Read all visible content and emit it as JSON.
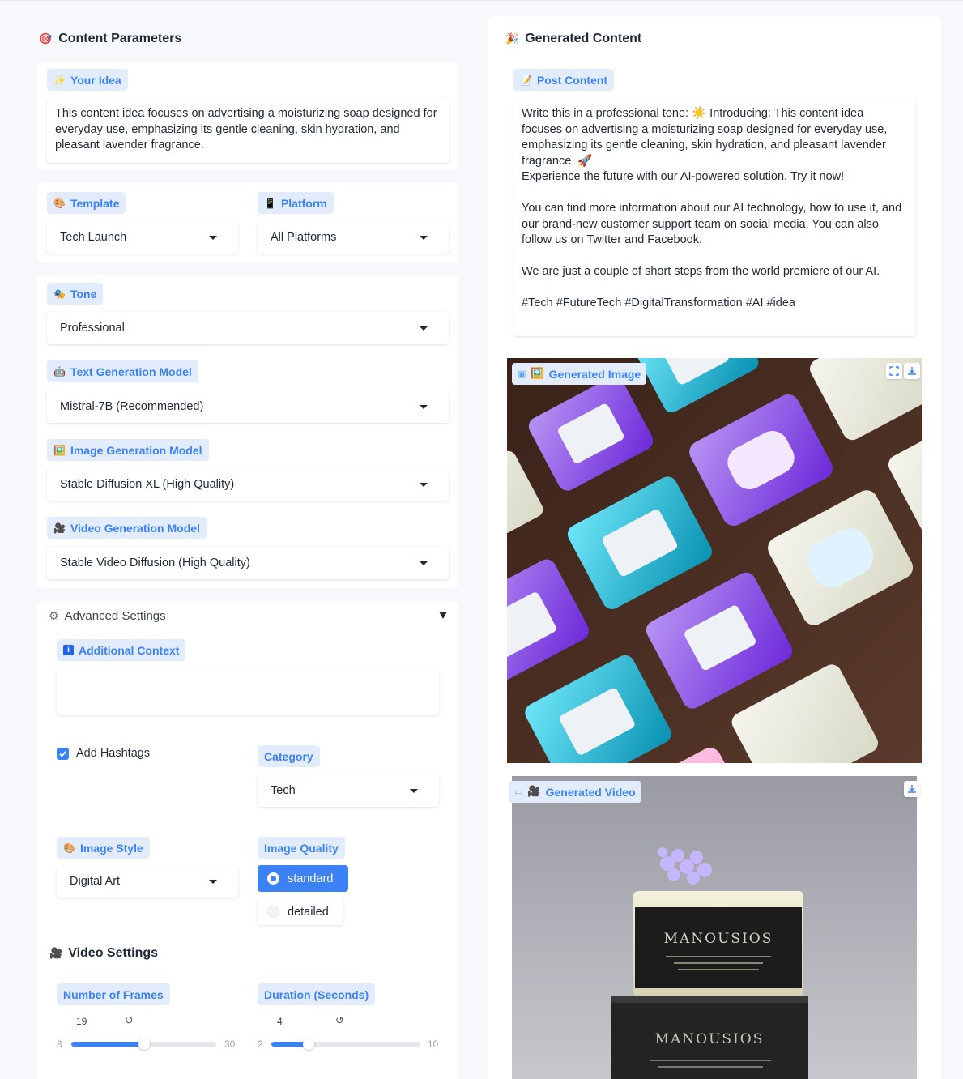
{
  "left": {
    "title": "Content Parameters",
    "idea": {
      "label": "Your Idea",
      "value": "This content idea focuses on advertising a moisturizing soap designed for everyday use, emphasizing its gentle cleaning, skin hydration, and pleasant lavender fragrance."
    },
    "template": {
      "label": "Template",
      "value": "Tech Launch"
    },
    "platform": {
      "label": "Platform",
      "value": "All Platforms"
    },
    "tone": {
      "label": "Tone",
      "value": "Professional"
    },
    "text_model": {
      "label": "Text Generation Model",
      "value": "Mistral-7B (Recommended)"
    },
    "image_model": {
      "label": "Image Generation Model",
      "value": "Stable Diffusion XL (High Quality)"
    },
    "video_model": {
      "label": "Video Generation Model",
      "value": "Stable Video Diffusion (High Quality)"
    },
    "advanced": {
      "title": "Advanced Settings",
      "expanded": true,
      "additional_context": {
        "label": "Additional Context",
        "value": ""
      },
      "add_hashtags": {
        "label": "Add Hashtags",
        "checked": true
      },
      "category": {
        "label": "Category",
        "value": "Tech"
      },
      "image_style": {
        "label": "Image Style",
        "value": "Digital Art"
      },
      "image_quality": {
        "label": "Image Quality",
        "options": [
          "standard",
          "detailed"
        ],
        "selected": "standard"
      }
    },
    "video_settings": {
      "title": "Video Settings",
      "frames": {
        "label": "Number of Frames",
        "value": 19,
        "min": 8,
        "max": 30,
        "reset": "↺"
      },
      "duration": {
        "label": "Duration (Seconds)",
        "value": 4,
        "min": 2,
        "max": 10,
        "reset": "↺"
      }
    }
  },
  "right": {
    "title": "Generated Content",
    "post": {
      "label": "Post Content",
      "paragraphs": [
        "Write this in a professional tone: ☀️ Introducing: This content idea focuses on advertising a moisturizing soap designed for everyday use, emphasizing its gentle cleaning, skin hydration, and pleasant lavender fragrance.  🚀",
        "Experience the future with our AI-powered solution. Try it now!",
        "",
        "You can find more information about our AI technology, how to use it, and our brand-new customer support team on social media. You can also follow us on Twitter and Facebook.",
        "",
        "We are just a couple of short steps from the world premiere of our AI.",
        "",
        "#Tech #FutureTech #DigitalTransformation #AI #idea"
      ]
    },
    "image": {
      "label": "Generated Image"
    },
    "video": {
      "label": "Generated Video"
    },
    "video_soap_text": {
      "top": "MANOUSIOS",
      "bottom": "MANOUSIOS"
    }
  },
  "colors": {
    "accent": "#3b82f6",
    "chip_bg": "#e3ecfd",
    "page_bg": "#f7f8fb"
  }
}
